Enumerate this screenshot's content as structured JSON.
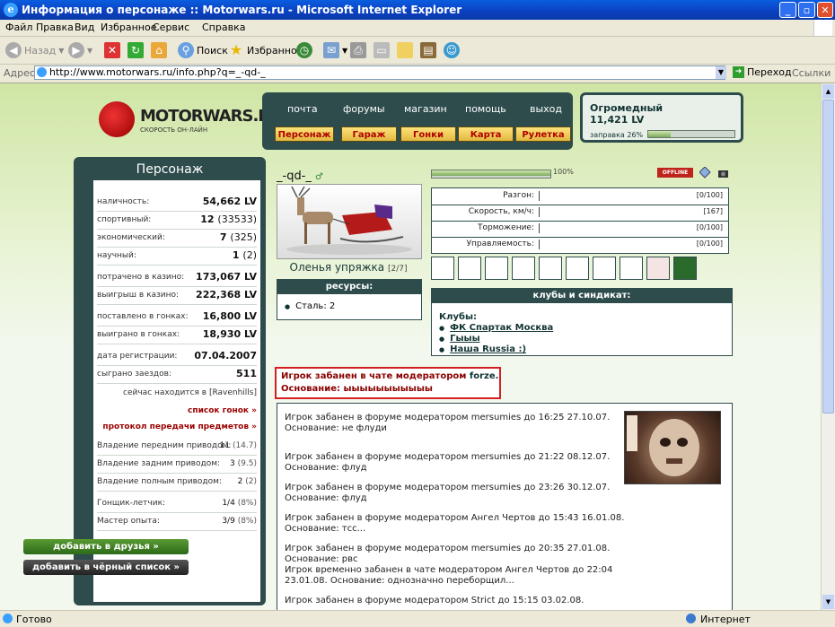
{
  "window": {
    "title": "Информация о персонаже :: Motorwars.ru - Microsoft Internet Explorer"
  },
  "menu": [
    "Файл",
    "Правка",
    "Вид",
    "Избранное",
    "Сервис",
    "Справка"
  ],
  "toolbar": {
    "back": "Назад",
    "search": "Поиск",
    "favorites": "Избранное"
  },
  "address": {
    "label": "Адрес:",
    "url": "http://www.motorwars.ru/info.php?q=_-qd-_",
    "go": "Переход",
    "links": "Ссылки"
  },
  "status": {
    "text": "Готово",
    "zone": "Интернет"
  },
  "site": {
    "logo": "MOTORWARS.RU",
    "logo_sub": "СКОРОСТЬ ОН-ЛАЙН",
    "nav_top": [
      "почта",
      "форумы",
      "магазин",
      "помощь",
      "выход"
    ],
    "nav_buttons": [
      "Персонаж",
      "Гараж",
      "Гонки",
      "Карта",
      "Рулетка"
    ],
    "money": {
      "name": "Огромедный",
      "amount": "11,421 LV",
      "fuel_label": "заправка 26%",
      "fuel_fraction": 0.26
    }
  },
  "left": {
    "title": "Персонаж",
    "rows": [
      {
        "k": "наличность:",
        "v": "54,662 LV",
        "n": ""
      },
      {
        "k": "спортивный:",
        "v": "12",
        "n": "(33533)"
      },
      {
        "k": "экономический:",
        "v": "7",
        "n": "(325)"
      },
      {
        "k": "научный:",
        "v": "1",
        "n": "(2)"
      },
      {
        "k": "потрачено в казино:",
        "v": "173,067 LV",
        "n": ""
      },
      {
        "k": "выигрыш в казино:",
        "v": "222,368 LV",
        "n": ""
      },
      {
        "k": "поставлено в гонках:",
        "v": "16,800 LV",
        "n": ""
      },
      {
        "k": "выиграно в гонках:",
        "v": "18,930 LV",
        "n": ""
      },
      {
        "k": "дата регистрации:",
        "v": "07.04.2007",
        "n": ""
      },
      {
        "k": "сыграно заездов:",
        "v": "511",
        "n": ""
      }
    ],
    "location": "сейчас находится в [Ravenhills]",
    "race_list": "список гонок »",
    "transfer": "протокол передачи предметов »",
    "skills": [
      {
        "k": "Владение передним приводом:",
        "v": "11",
        "n": "(14.7)"
      },
      {
        "k": "Владение задним приводом:",
        "v": "3",
        "n": "(9.5)"
      },
      {
        "k": "Владение полным приводом:",
        "v": "2",
        "n": "(2)"
      },
      {
        "k": "Гонщик-летчик:",
        "v": "1/4",
        "n": "(8%)"
      },
      {
        "k": "Мастер опыта:",
        "v": "3/9",
        "n": "(8%)"
      }
    ],
    "add_friend": "добавить в друзья »",
    "add_black": "добавить в чёрный список »"
  },
  "center": {
    "nick": "_-qd-_",
    "car_name": "Оленья упряжка",
    "car_mod": "[2/7]",
    "resources_title": "ресурсы:",
    "resources": [
      "Сталь: 2"
    ],
    "progress_label": "100%",
    "progress_fraction": 1.0,
    "offline": "OFFLINE",
    "stats": [
      {
        "k": "Разгон:",
        "v": "[0/100]"
      },
      {
        "k": "Скорость, км/ч:",
        "v": "[167]"
      },
      {
        "k": "Торможение:",
        "v": "[0/100]"
      },
      {
        "k": "Управляемость:",
        "v": "[0/100]"
      }
    ],
    "clubs_title": "клубы и синдикат:",
    "clubs_label": "Клубы:",
    "clubs": [
      "ФК Спартак Москва",
      "Гыыы",
      "Наша Russia :)"
    ],
    "chat_ban": {
      "prefix": "Игрок забанен в чате модератором",
      "moderator": "forze.",
      "reason": "Основание: ыыыыыыыыыыы"
    },
    "log": [
      "Игрок забанен в форуме модератором mersumies до 16:25 27.10.07. Основание: не флуди",
      "Игрок забанен в форуме модератором mersumies до 21:22 08.12.07. Основание: флуд",
      "Игрок забанен в форуме модератором mersumies до 23:26 30.12.07. Основание: флуд",
      "Игрок забанен в форуме модератором Ангел Чертов до 15:43 16.01.08. Основание: тсс...",
      "Игрок забанен в форуме модератором mersumies до 20:35 27.01.08. Основание: рвс",
      "Игрок временно забанен в чате модератором Ангел Чертов до 22:04 23.01.08. Основание: однозначно переборщил...",
      "Игрок забанен в форуме модератором Strict до 15:15 03.02.08."
    ]
  }
}
